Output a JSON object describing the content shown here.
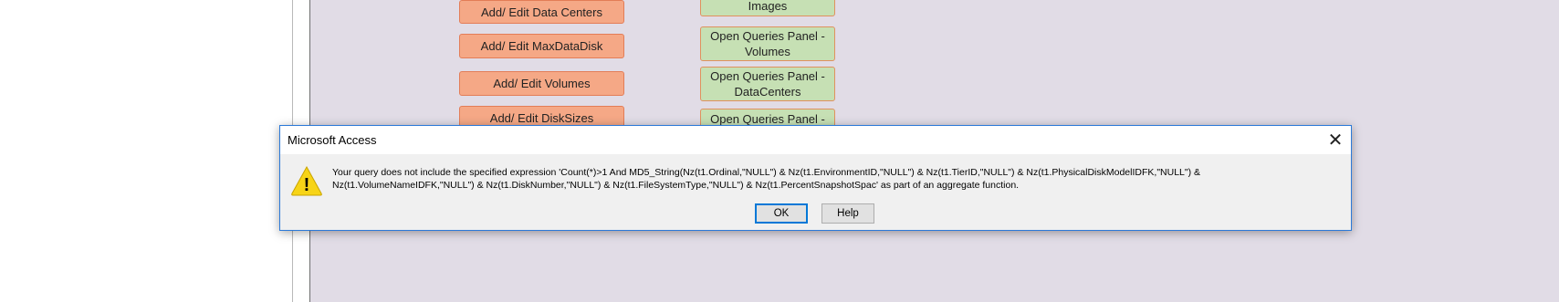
{
  "form": {
    "buttons_left": [
      "Add/ Edit Data Centers",
      "Add/ Edit MaxDataDisk",
      "Add/ Edit Volumes",
      "Add/ Edit DiskSizes"
    ],
    "buttons_right": [
      "Images",
      "Open Queries Panel -\nVolumes",
      "Open Queries Panel -\nDataCenters",
      "Open Queries Panel -"
    ]
  },
  "dialog": {
    "title": "Microsoft Access",
    "close_glyph": "✕",
    "icon": "warning-icon",
    "icon_glyph": "!",
    "message": "Your query does not include the specified expression 'Count(*)>1 And MD5_String(Nz(t1.Ordinal,\"NULL\") & Nz(t1.EnvironmentID,\"NULL\") & Nz(t1.TierID,\"NULL\") & Nz(t1.PhysicalDiskModelIDFK,\"NULL\") & Nz(t1.VolumeNameIDFK,\"NULL\") & Nz(t1.DiskNumber,\"NULL\") & Nz(t1.FileSystemType,\"NULL\") & Nz(t1.PercentSnapshotSpac' as part of an aggregate function.",
    "ok_label": "OK",
    "help_label": "Help"
  },
  "colors": {
    "form_background": "#e1dce6",
    "orange_button": "#f5a886",
    "green_button": "#c6e0b4",
    "dialog_border": "#2b79d8",
    "warning_yellow": "#f7d417"
  }
}
